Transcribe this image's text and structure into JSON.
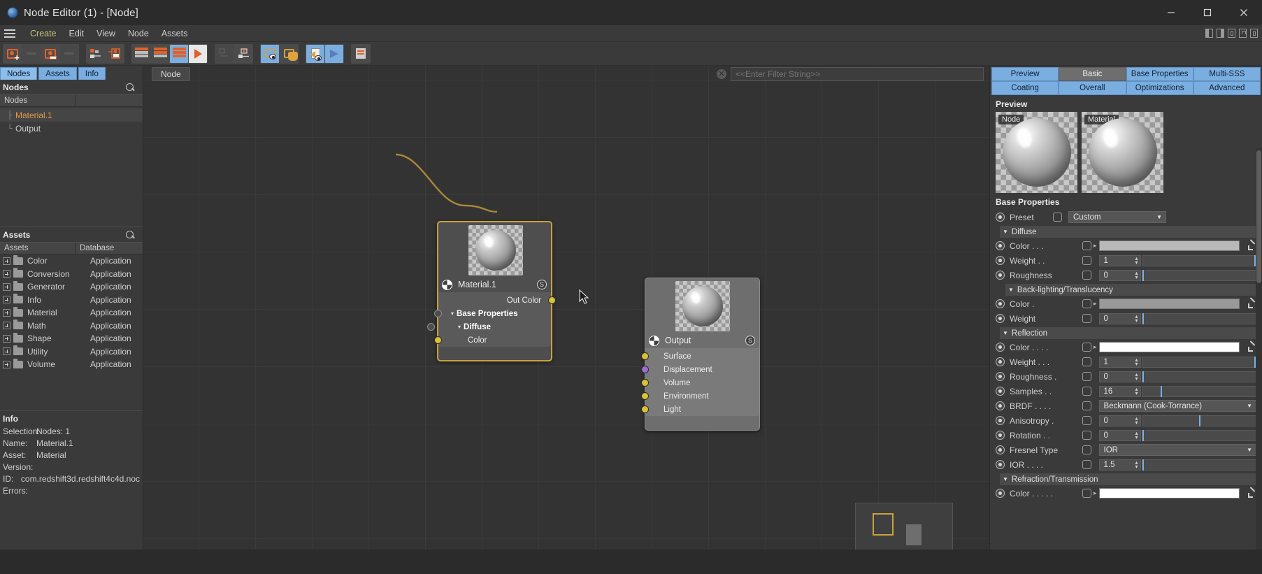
{
  "window": {
    "title": "Node Editor (1) - [Node]",
    "app_icon": "cinema4d-icon",
    "minimize": "─",
    "maximize": "□",
    "close": "✕"
  },
  "menubar": {
    "items": [
      "Create",
      "Edit",
      "View",
      "Node",
      "Assets"
    ],
    "right_icons": [
      "panel-left-icon",
      "panel-right-icon",
      "panel-split-icon",
      "lock-icon",
      "grid-icon"
    ]
  },
  "toolbar": {
    "groups": [
      {
        "buttons": [
          {
            "name": "add-node-button",
            "icon": "node-add-icon",
            "state": "normal"
          },
          {
            "name": "node-placeholder-1-button",
            "icon": "faint-dash-icon",
            "state": "dim"
          },
          {
            "name": "node-connect-button",
            "icon": "node-arrow-icon",
            "state": "normal"
          },
          {
            "name": "node-placeholder-2-button",
            "icon": "faint-dash-icon",
            "state": "dim"
          }
        ]
      },
      {
        "buttons": [
          {
            "name": "group-nodes-button",
            "icon": "group-nodes-icon",
            "state": "normal"
          },
          {
            "name": "ungroup-nodes-button",
            "icon": "ungroup-nodes-icon",
            "state": "normal"
          }
        ]
      },
      {
        "buttons": [
          {
            "name": "node-display-small-button",
            "icon": "stack-small-icon",
            "state": "normal"
          },
          {
            "name": "node-display-medium-button",
            "icon": "stack-medium-icon",
            "state": "normal"
          },
          {
            "name": "node-display-large-button",
            "icon": "stack-large-icon",
            "state": "selected"
          },
          {
            "name": "play-preview-button",
            "icon": "play-icon",
            "state": "light"
          }
        ]
      },
      {
        "buttons": [
          {
            "name": "layout-grid-button",
            "icon": "layout-grid-icon",
            "state": "dim"
          },
          {
            "name": "node-port-button",
            "icon": "node-port-icon",
            "state": "normal"
          }
        ]
      },
      {
        "buttons": [
          {
            "name": "show-preview-all-button",
            "icon": "preview-all-icon",
            "state": "selected"
          },
          {
            "name": "pick-material-button",
            "icon": "hand-pick-icon",
            "state": "normal"
          }
        ]
      },
      {
        "buttons": [
          {
            "name": "page-preview-button",
            "icon": "page-preview-icon",
            "state": "selected"
          },
          {
            "name": "brush-preview-button",
            "icon": "brush-preview-icon",
            "state": "selected"
          }
        ]
      },
      {
        "buttons": [
          {
            "name": "document-settings-button",
            "icon": "document-icon",
            "state": "normal"
          }
        ]
      }
    ]
  },
  "left_panel": {
    "tabs": [
      {
        "label": "Nodes",
        "active": true
      },
      {
        "label": "Assets",
        "active": false
      },
      {
        "label": "Info",
        "active": false
      }
    ],
    "nodes_section": {
      "title": "Nodes",
      "search_icon": "search-icon",
      "column_headers": [
        "Nodes",
        ""
      ],
      "tree": [
        {
          "label": "Material.1",
          "color": "orange",
          "elbow": "├"
        },
        {
          "label": "Output",
          "color": "normal",
          "elbow": "└"
        }
      ]
    },
    "assets_section": {
      "title": "Assets",
      "search_icon": "search-icon",
      "column_headers": [
        "Assets",
        "Database"
      ],
      "rows": [
        {
          "name": "Color",
          "database": "Application"
        },
        {
          "name": "Conversion",
          "database": "Application"
        },
        {
          "name": "Generator",
          "database": "Application"
        },
        {
          "name": "Info",
          "database": "Application"
        },
        {
          "name": "Material",
          "database": "Application"
        },
        {
          "name": "Math",
          "database": "Application"
        },
        {
          "name": "Shape",
          "database": "Application"
        },
        {
          "name": "Utility",
          "database": "Application"
        },
        {
          "name": "Volume",
          "database": "Application"
        }
      ]
    },
    "info_section": {
      "title": "Info",
      "rows": [
        {
          "key": "Selection:",
          "value": "Nodes: 1"
        },
        {
          "key": "Name:",
          "value": "Material.1"
        },
        {
          "key": "Asset:",
          "value": "Material"
        },
        {
          "key": "Version:",
          "value": ""
        },
        {
          "key": "ID:",
          "value": "com.redshift3d.redshift4c4d.noc"
        },
        {
          "key": "Errors:",
          "value": ""
        }
      ]
    }
  },
  "graph": {
    "breadcrumb": "Node",
    "filter_placeholder": "<<Enter Filter String>>",
    "filter_value": "",
    "clear_icon": "clear-filter-icon",
    "nodes": [
      {
        "id": "material",
        "title": "Material.1",
        "badge": "S",
        "icon": "material-node-icon",
        "outputs": [
          {
            "label": "Out Color",
            "color": "#d8c432"
          }
        ],
        "groups": [
          {
            "label": "Base Properties",
            "caret": "▾"
          },
          {
            "label": "Diffuse",
            "caret": "▾"
          }
        ],
        "sub_ports": [
          {
            "label": "Color",
            "color": "#d8c432"
          }
        ]
      },
      {
        "id": "output",
        "title": "Output",
        "badge": "S",
        "icon": "output-node-icon",
        "inputs": [
          {
            "label": "Surface",
            "color": "#d8c432"
          },
          {
            "label": "Displacement",
            "color": "#9a6fd0"
          },
          {
            "label": "Volume",
            "color": "#d8c432"
          },
          {
            "label": "Environment",
            "color": "#d8c432"
          },
          {
            "label": "Light",
            "color": "#d8c432"
          }
        ]
      }
    ],
    "connection_color": "#a8873a"
  },
  "right_panel": {
    "tabs": [
      {
        "label": "Preview",
        "active": true
      },
      {
        "label": "Basic",
        "active": false
      },
      {
        "label": "Base Properties",
        "active": true
      },
      {
        "label": "Multi-SSS",
        "active": true
      },
      {
        "label": "Coating",
        "active": true
      },
      {
        "label": "Overall",
        "active": true
      },
      {
        "label": "Optimizations",
        "active": true
      },
      {
        "label": "Advanced",
        "active": true
      }
    ],
    "preview": {
      "title": "Preview",
      "boxes": [
        {
          "tag": "Node"
        },
        {
          "tag": "Material"
        }
      ]
    },
    "base_properties": {
      "title": "Base Properties",
      "preset": {
        "label": "Preset",
        "value": "Custom"
      },
      "sections": [
        {
          "name": "Diffuse",
          "indent": 1,
          "rows": [
            {
              "label": "Color . . .",
              "type": "color",
              "value": "#b9b9b9",
              "has_chevron": true,
              "has_picker": true
            },
            {
              "label": "Weight . .",
              "type": "number",
              "value": "1",
              "slider": 100
            },
            {
              "label": "Roughness",
              "type": "number",
              "value": "0",
              "slider": 0
            }
          ]
        },
        {
          "name": "Back-lighting/Translucency",
          "indent": 2,
          "rows": [
            {
              "label": "Color .",
              "type": "color",
              "value": "#9a9a9a",
              "has_chevron": true,
              "has_picker": true
            },
            {
              "label": "Weight",
              "type": "number",
              "value": "0",
              "slider": 0
            }
          ]
        },
        {
          "name": "Reflection",
          "indent": 1,
          "rows": [
            {
              "label": "Color . . . .",
              "type": "color",
              "value": "#ffffff",
              "has_chevron": true,
              "has_picker": true
            },
            {
              "label": "Weight . . .",
              "type": "number",
              "value": "1",
              "slider": 100
            },
            {
              "label": "Roughness .",
              "type": "number",
              "value": "0",
              "slider": 0
            },
            {
              "label": "Samples . .",
              "type": "number",
              "value": "16",
              "slider": 16
            },
            {
              "label": "BRDF . . . .",
              "type": "dropdown",
              "value": "Beckmann (Cook-Torrance)"
            },
            {
              "label": "Anisotropy .",
              "type": "number",
              "value": "0",
              "slider": 50
            },
            {
              "label": "Rotation . .",
              "type": "number",
              "value": "0",
              "slider": 0
            },
            {
              "label": "Fresnel Type",
              "type": "dropdown",
              "value": "IOR"
            },
            {
              "label": "IOR . . . .",
              "type": "number",
              "value": "1.5",
              "slider": 0
            }
          ]
        },
        {
          "name": "Refraction/Transmission",
          "indent": 1,
          "rows": [
            {
              "label": "Color . . . . .",
              "type": "color",
              "value": "#ffffff",
              "has_chevron": true,
              "has_picker": true
            }
          ]
        }
      ]
    }
  }
}
